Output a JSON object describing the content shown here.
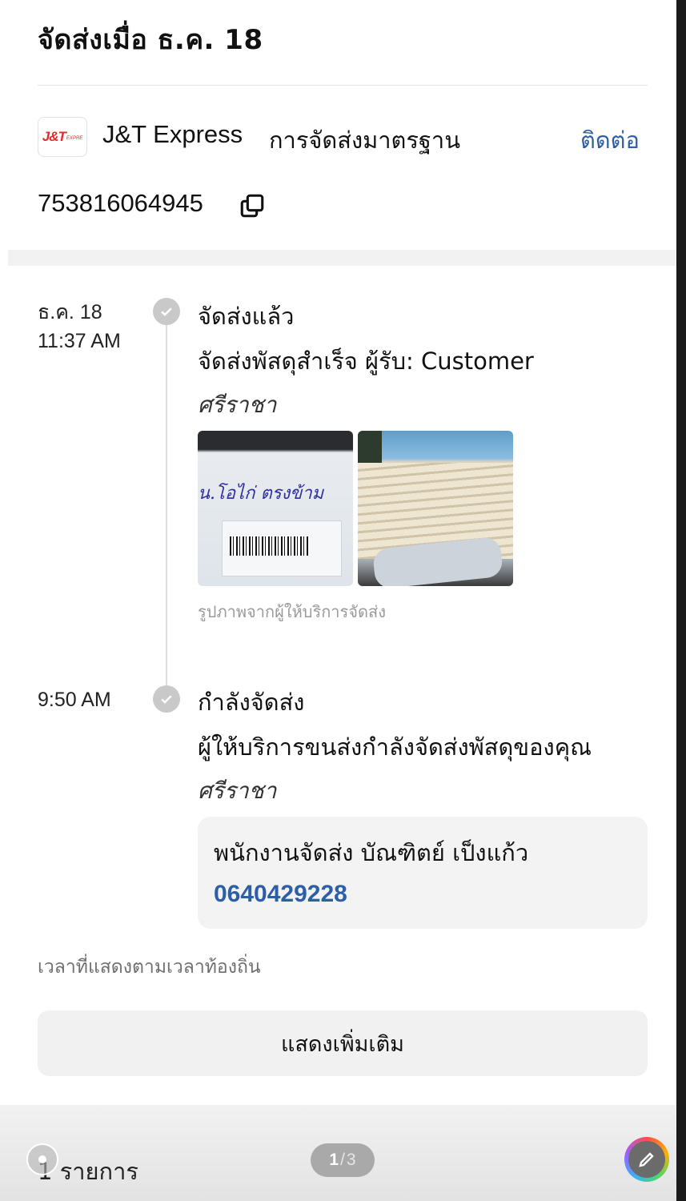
{
  "header": {
    "title": "จัดส่งเมื่อ ธ.ค. 18"
  },
  "carrier": {
    "logo_text": "J&T",
    "logo_small": "EXPRE",
    "name": "J&T Express",
    "service": "การจัดส่งมาตรฐาน",
    "contact_label": "ติดต่อ",
    "tracking_number": "753816064945"
  },
  "events": [
    {
      "date": "ธ.ค. 18",
      "time": "11:37 AM",
      "title": "จัดส่งแล้ว",
      "description": "จัดส่งพัสดุสำเร็จ ผู้รับ: Customer",
      "location": "ศรีราชา",
      "photo_handwriting": "น.โอไก่ ตรงข้าม",
      "photo_caption": "รูปภาพจากผู้ให้บริการจัดส่ง"
    },
    {
      "time": "9:50 AM",
      "title": "กำลังจัดส่ง",
      "description": "ผู้ให้บริการขนส่งกำลังจัดส่งพัสดุของคุณ",
      "location": "ศรีราชา",
      "courier_label": "พนักงานจัดส่ง  บัณฑิตย์ เป็งแก้ว",
      "courier_phone": "0640429228"
    }
  ],
  "note": "เวลาที่แสดงตามเวลาท้องถิ่น",
  "more_button": "แสดงเพิ่มเติม",
  "footer": {
    "items_count": "1 รายการ",
    "page_current": "1",
    "page_sep": "/",
    "page_total": "3"
  },
  "colors": {
    "link": "#2d5fa7",
    "logo_red": "#e22b2b"
  },
  "icons": [
    "copy-icon",
    "check-icon",
    "edit-pencil-icon"
  ]
}
